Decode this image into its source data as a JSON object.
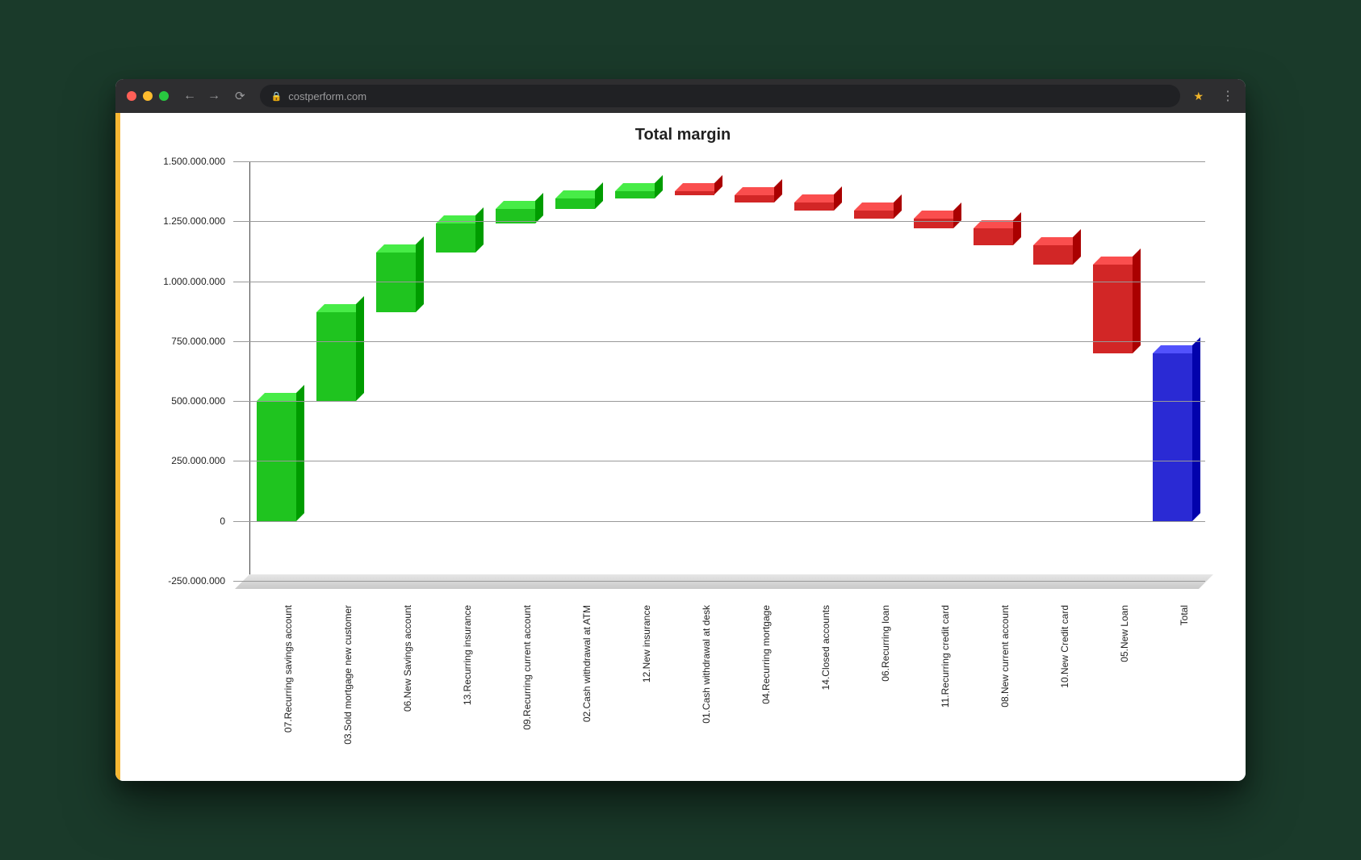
{
  "browser": {
    "url_host": "costperform.com"
  },
  "chart_data": {
    "type": "waterfall",
    "title": "Total margin",
    "ylabel": "",
    "xlabel": "",
    "ylim": [
      -250000000,
      1500000000
    ],
    "y_ticks": [
      -250000000,
      0,
      250000000,
      500000000,
      750000000,
      1000000000,
      1250000000,
      1500000000
    ],
    "y_tick_labels": [
      "-250.000.000",
      "0",
      "250.000.000",
      "500.000.000",
      "750.000.000",
      "1.000.000.000",
      "1.250.000.000",
      "1.500.000.000"
    ],
    "categories": [
      "07.Recurring savings account",
      "03.Sold mortgage new customer",
      "06.New Savings account",
      "13.Recurring insurance",
      "09.Recurring current account",
      "02.Cash withdrawal at ATM",
      "12.New insurance",
      "01.Cash withdrawal at desk",
      "04.Recurring mortgage",
      "14.Closed accounts",
      "06.Recurring loan",
      "11.Recurring credit card",
      "08.New current account",
      "10.New Credit card",
      "05.New Loan",
      "Total"
    ],
    "series": [
      {
        "name": "delta",
        "values": [
          500000000,
          370000000,
          250000000,
          120000000,
          60000000,
          45000000,
          30000000,
          -15000000,
          -30000000,
          -35000000,
          -35000000,
          -40000000,
          -70000000,
          -80000000,
          -370000000,
          700000000
        ],
        "is_total": [
          false,
          false,
          false,
          false,
          false,
          false,
          false,
          false,
          false,
          false,
          false,
          false,
          false,
          false,
          false,
          true
        ]
      }
    ],
    "colors": {
      "positive": "#1fc41f",
      "negative": "#d22626",
      "total": "#2a2ad4"
    }
  }
}
